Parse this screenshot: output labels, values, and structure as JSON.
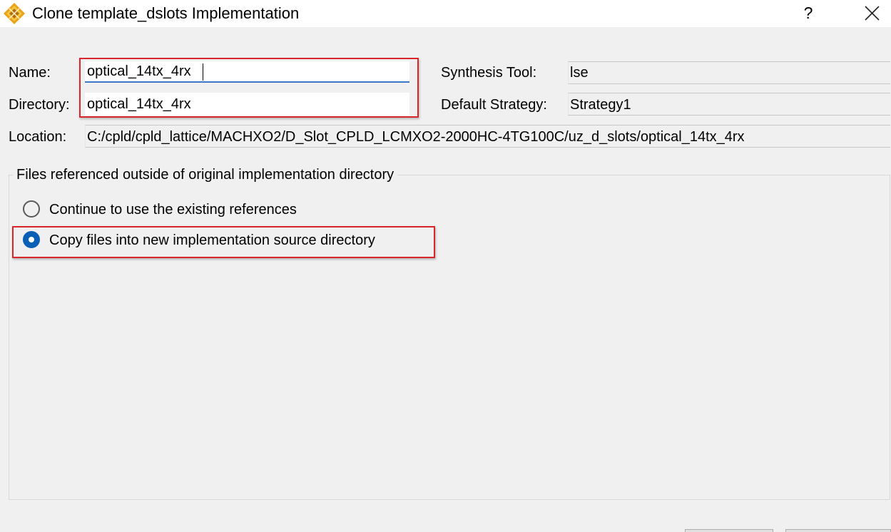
{
  "window": {
    "title": "Clone template_dslots Implementation",
    "app_icon": "lattice-diamond-icon",
    "help_label": "?",
    "close_icon": "close-icon"
  },
  "form": {
    "name_label": "Name:",
    "name_value": "optical_14tx_4rx",
    "directory_label": "Directory:",
    "directory_value": "optical_14tx_4rx",
    "location_label": "Location:",
    "location_value": "C:/cpld/cpld_lattice/MACHXO2/D_Slot_CPLD_LCMXO2-2000HC-4TG100C/uz_d_slots/optical_14tx_4rx",
    "synthesis_tool_label": "Synthesis Tool:",
    "synthesis_tool_value": "lse",
    "default_strategy_label": "Default Strategy:",
    "default_strategy_value": "Strategy1"
  },
  "files_group": {
    "title": "Files referenced outside of original implementation directory",
    "options": [
      {
        "label": "Continue to use the existing references",
        "selected": false
      },
      {
        "label": "Copy files into new implementation source directory",
        "selected": true
      }
    ]
  },
  "colors": {
    "highlight_border": "#d9262c",
    "radio_selected": "#0a5fb4",
    "focus_underline": "#3c78c3"
  }
}
